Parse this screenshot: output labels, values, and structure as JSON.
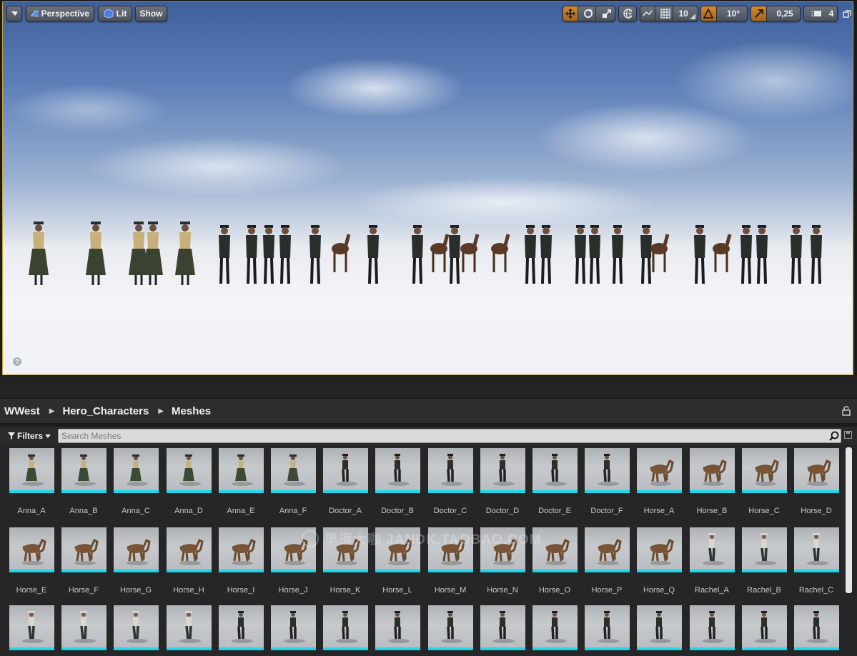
{
  "viewport": {
    "toolbar": {
      "perspective_label": "Perspective",
      "lit_label": "Lit",
      "show_label": "Show",
      "grid_snap_value": "10",
      "rotation_snap_value": "10°",
      "scale_snap_value": "0,25",
      "camera_speed_value": "4"
    },
    "help_glyph": "?"
  },
  "content_browser": {
    "breadcrumb": [
      "WWest",
      "Hero_Characters",
      "Meshes"
    ],
    "filters_label": "Filters",
    "search_placeholder": "Search Meshes",
    "assets": [
      {
        "name": "Anna_A",
        "kind": "woman"
      },
      {
        "name": "Anna_B",
        "kind": "woman"
      },
      {
        "name": "Anna_C",
        "kind": "woman"
      },
      {
        "name": "Anna_D",
        "kind": "woman"
      },
      {
        "name": "Anna_E",
        "kind": "woman"
      },
      {
        "name": "Anna_F",
        "kind": "woman"
      },
      {
        "name": "Doctor_A",
        "kind": "man"
      },
      {
        "name": "Doctor_B",
        "kind": "man"
      },
      {
        "name": "Doctor_C",
        "kind": "man"
      },
      {
        "name": "Doctor_D",
        "kind": "man"
      },
      {
        "name": "Doctor_E",
        "kind": "man"
      },
      {
        "name": "Doctor_F",
        "kind": "man"
      },
      {
        "name": "Horse_A",
        "kind": "horse"
      },
      {
        "name": "Horse_B",
        "kind": "horse"
      },
      {
        "name": "Horse_C",
        "kind": "horse"
      },
      {
        "name": "Horse_D",
        "kind": "horse"
      },
      {
        "name": "Horse_E",
        "kind": "horse"
      },
      {
        "name": "Horse_F",
        "kind": "horse"
      },
      {
        "name": "Horse_G",
        "kind": "horse"
      },
      {
        "name": "Horse_H",
        "kind": "horse"
      },
      {
        "name": "Horse_I",
        "kind": "horse"
      },
      {
        "name": "Horse_J",
        "kind": "horse"
      },
      {
        "name": "Horse_K",
        "kind": "horse"
      },
      {
        "name": "Horse_L",
        "kind": "horse"
      },
      {
        "name": "Horse_M",
        "kind": "horse"
      },
      {
        "name": "Horse_N",
        "kind": "horse"
      },
      {
        "name": "Horse_O",
        "kind": "horse"
      },
      {
        "name": "Horse_P",
        "kind": "horse"
      },
      {
        "name": "Horse_Q",
        "kind": "horse"
      },
      {
        "name": "Rachel_A",
        "kind": "rachel"
      },
      {
        "name": "Rachel_B",
        "kind": "rachel"
      },
      {
        "name": "Rachel_C",
        "kind": "rachel"
      },
      {
        "name": "",
        "kind": "rachel"
      },
      {
        "name": "",
        "kind": "rachel"
      },
      {
        "name": "",
        "kind": "rachel"
      },
      {
        "name": "",
        "kind": "rachel"
      },
      {
        "name": "",
        "kind": "man"
      },
      {
        "name": "",
        "kind": "man"
      },
      {
        "name": "",
        "kind": "man"
      },
      {
        "name": "",
        "kind": "man"
      },
      {
        "name": "",
        "kind": "man"
      },
      {
        "name": "",
        "kind": "man"
      },
      {
        "name": "",
        "kind": "man"
      },
      {
        "name": "",
        "kind": "man"
      },
      {
        "name": "",
        "kind": "man"
      },
      {
        "name": "",
        "kind": "man"
      },
      {
        "name": "",
        "kind": "man"
      },
      {
        "name": "",
        "kind": "man"
      }
    ]
  },
  "watermark": "早道大咖  JANDK.TAOBAO.COM",
  "colors": {
    "accent_orange": "#d48a26",
    "viewport_border": "#c9a23a",
    "thumbnail_underline": "#1fd5e8"
  }
}
